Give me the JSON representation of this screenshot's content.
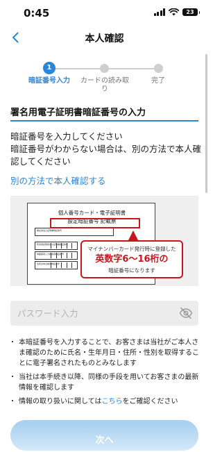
{
  "status_bar": {
    "time": "0:45",
    "battery": "23",
    "icons": [
      "cellular-signal-icon",
      "wifi-icon",
      "battery-icon"
    ]
  },
  "nav": {
    "title": "本人確認",
    "back_icon": "chevron-left-icon"
  },
  "stepper": {
    "current_step": 1,
    "steps": [
      {
        "number": "1",
        "label": "暗証番号入力",
        "state": "active"
      },
      {
        "number": "",
        "label": "カードの読み取り",
        "state": "pending"
      },
      {
        "number": "",
        "label": "完了",
        "state": "pending"
      }
    ]
  },
  "section": {
    "title": "署名用電子証明書暗証番号の入力"
  },
  "instructions": {
    "line1": "暗証番号を入力してください",
    "line2": "暗証番号がわからない場合は、別の方法で本人確認してください"
  },
  "alt_link": "別の方法で本人確認する",
  "illustration": {
    "heading1": "個人番号カード・電子証明書",
    "heading2": "設定暗証番号 記載票",
    "row_label1": "署名用電子証明書暗証番号",
    "row_label2": "利用者証明用電子証明書暗証番号",
    "row_label3": "券面事項入力補助用暗証番号",
    "row_label4": "住民基本台帳用暗証番号",
    "callout_line1": "マイナンバーカード発行時に登録した",
    "callout_line2": "英数字6〜16桁の",
    "callout_line3": "暗証番号になります"
  },
  "password": {
    "placeholder": "パスワード入力",
    "value": "",
    "toggle_icon": "eye-slash-icon"
  },
  "notes": {
    "items": [
      "本暗証番号を入力することで、お客さまは当社がご本人さま確認のために氏名・生年月日・住所・性別を取得することに電子署名されたものとみなします",
      "当社は本手続き以降、同様の手段を用いてお客さまの最新情報を確認します"
    ],
    "item3_prefix": "情報の取り扱いに関しては",
    "item3_link": "こちら",
    "item3_suffix": "をご確認ください"
  },
  "next_button": "次へ",
  "colors": {
    "accent": "#2a86d6",
    "highlight_red": "#c8161d",
    "disabled_button": "#a9d1f2",
    "input_bg": "#ececec"
  }
}
